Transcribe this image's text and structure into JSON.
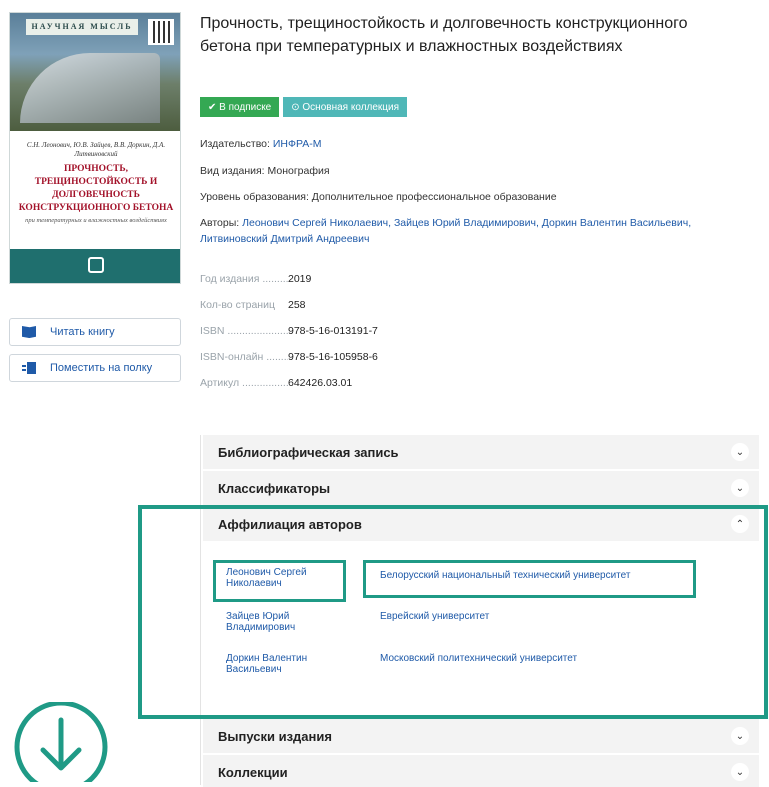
{
  "cover": {
    "publisher_band": "НАУЧНАЯ МЫСЛЬ",
    "authors": "С.Н. Леонович, Ю.В. Зайцев, В.В. Доркин, Д.А. Литвиновский",
    "title": "ПРОЧНОСТЬ, ТРЕЩИНОСТОЙКОСТЬ И ДОЛГОВЕЧНОСТЬ КОНСТРУКЦИОННОГО БЕТОНА",
    "subtitle": "при температурных и влажностных воздействиях"
  },
  "sidebar": {
    "read_label": "Читать книгу",
    "shelf_label": "Поместить на полку"
  },
  "book": {
    "title": "Прочность, трещиностойкость и долговечность конструкционного бетона при температурных и влажностных воздействиях",
    "badge_subscription": "✔ В подписке",
    "badge_collection": "⊙ Основная коллекция",
    "publisher_label": "Издательство:",
    "publisher_value": "ИНФРА-М",
    "edition_type": "Вид издания: Монография",
    "education_level": "Уровень образования: Дополнительное профессиональное образование",
    "authors_label": "Авторы:",
    "authors_value": "Леонович Сергей Николаевич, Зайцев Юрий Владимирович, Доркин Валентин Васильевич, Литвиновский Дмитрий Андреевич"
  },
  "specs": [
    {
      "key": "Год издания ..............",
      "value": "2019"
    },
    {
      "key": "Кол-во страниц",
      "value": "258"
    },
    {
      "key": "ISBN ...........................",
      "value": "978-5-16-013191-7"
    },
    {
      "key": "ISBN-онлайн .........",
      "value": "978-5-16-105958-6"
    },
    {
      "key": "Артикул ........................",
      "value": "642426.03.01"
    }
  ],
  "accordion": {
    "bibliographic": "Библиографическая запись",
    "classifiers": "Классификаторы",
    "affiliation": "Аффилиация авторов",
    "issues": "Выпуски издания",
    "collections": "Коллекции"
  },
  "affiliations": [
    {
      "author": "Леонович Сергей Николаевич",
      "org": "Белорусский национальный технический университет"
    },
    {
      "author": "Зайцев Юрий Владимирович",
      "org": "Еврейский университет"
    },
    {
      "author": "Доркин Валентин Васильевич",
      "org": "Московский политехнический университет"
    }
  ],
  "colors": {
    "accent_link": "#1f5aa8",
    "highlight": "#1f9a86",
    "badge_green": "#34a853",
    "badge_teal": "#4fb7b7"
  },
  "icons": {
    "chevron_collapsed": "chevron-down-icon",
    "chevron_expanded": "chevron-up-icon",
    "download": "download-arrow-icon"
  }
}
